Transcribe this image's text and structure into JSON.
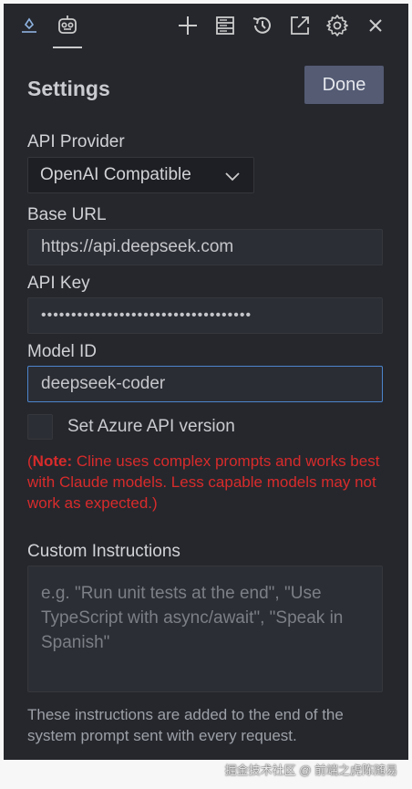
{
  "toolbar": {
    "icons": [
      "chat-icon",
      "robot-icon",
      "plus-icon",
      "server-icon",
      "history-icon",
      "popout-icon",
      "gear-icon",
      "close-icon"
    ]
  },
  "header": {
    "title": "Settings",
    "done_label": "Done"
  },
  "form": {
    "provider_label": "API Provider",
    "provider_value": "OpenAI Compatible",
    "base_url_label": "Base URL",
    "base_url_value": "https://api.deepseek.com",
    "api_key_label": "API Key",
    "api_key_value": "•••••••••••••••••••••••••••••••••••",
    "model_id_label": "Model ID",
    "model_id_value": "deepseek-coder",
    "azure_label": "Set Azure API version",
    "azure_checked": false,
    "note_prefix": "(",
    "note_bold": "Note:",
    "note_text": " Cline uses complex prompts and works best with Claude models. Less capable models may not work as expected.)",
    "custom_label": "Custom Instructions",
    "custom_placeholder": "e.g. \"Run unit tests at the end\", \"Use TypeScript with async/await\", \"Speak in Spanish\"",
    "custom_help": "These instructions are added to the end of the system prompt sent with every request."
  },
  "watermark": "掘金技术社区 @ 前端之虎陈随易",
  "colors": {
    "panel_bg": "#25272d",
    "accent_button": "#545b73",
    "focus_border": "#4c84cc",
    "warning_text": "#d82b2b"
  }
}
